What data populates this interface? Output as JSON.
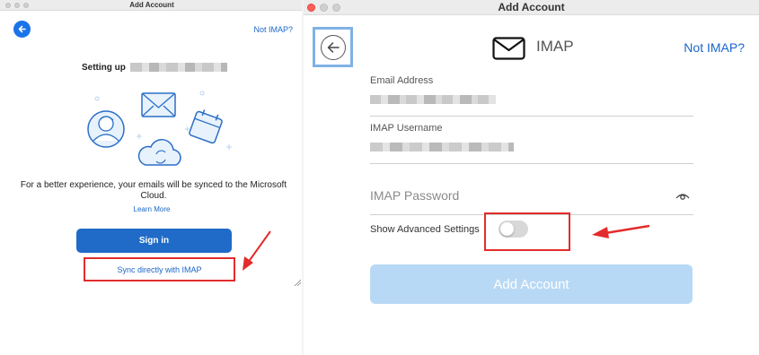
{
  "colors": {
    "accent": "#1a66c9",
    "highlight": "#e32b2b",
    "button_disabled": "#b8d9f5",
    "button_primary": "#1f6bc7"
  },
  "left": {
    "window_title": "Add Account",
    "not_imap": "Not IMAP?",
    "setting_up": "Setting up",
    "info_text": "For a better experience, your emails will be synced to the Microsoft Cloud.",
    "learn_more": "Learn More",
    "sign_in": "Sign in",
    "sync_imap": "Sync directly with IMAP"
  },
  "right": {
    "window_title": "Add Account",
    "header_title": "IMAP",
    "not_imap": "Not IMAP?",
    "email_label": "Email Address",
    "username_label": "IMAP Username",
    "password_placeholder": "IMAP Password",
    "show_advanced": "Show Advanced Settings",
    "advanced_enabled": false,
    "add_account": "Add Account"
  }
}
